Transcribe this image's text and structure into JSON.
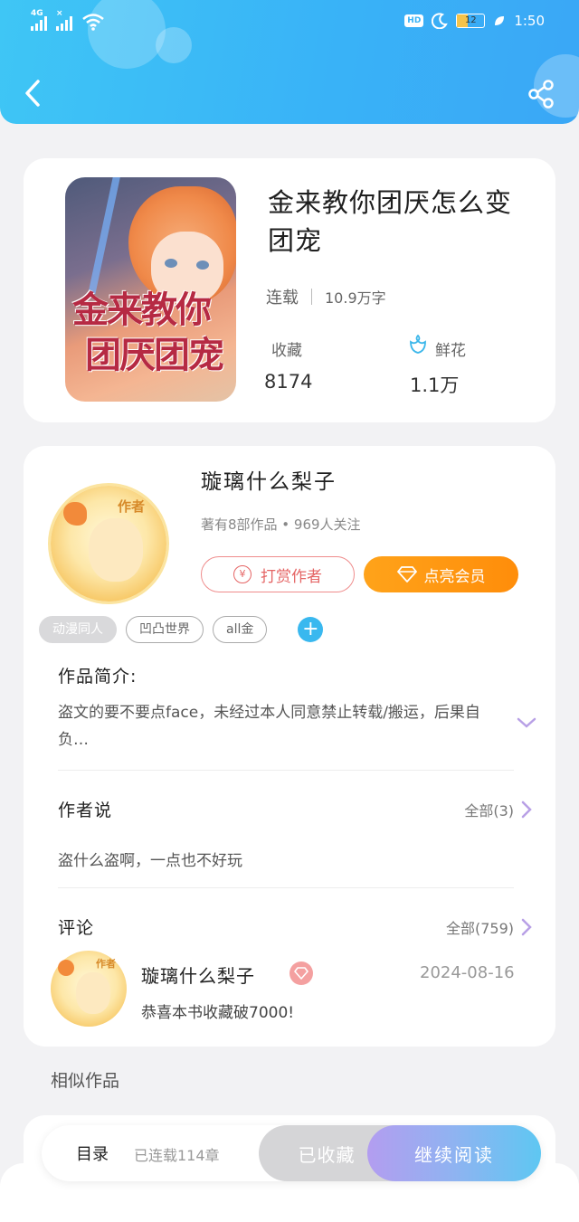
{
  "status_bar": {
    "network": "4G",
    "hd": "HD",
    "battery": "12",
    "time": "1:50"
  },
  "book": {
    "title": "金来教你团厌怎么变团宠",
    "status": "连载",
    "word_count": "10.9万字",
    "favorites_label": "收藏",
    "favorites_value": "8174",
    "flowers_label": "鲜花",
    "flowers_value": "1.1万",
    "cover": {
      "title_line1": "金来教你",
      "title_line2": "团厌团宠"
    }
  },
  "author": {
    "name": "璇璃什么梨子",
    "badge": "作者",
    "meta": "著有8部作品 • 969人关注",
    "tip_button": "打赏作者",
    "vip_button": "点亮会员",
    "yen_symbol": "¥"
  },
  "tags": [
    "动漫同人",
    "凹凸世界",
    "all金"
  ],
  "intro": {
    "label": "作品简介:",
    "text": "盗文的要不要点face，未经过本人同意禁止转载/搬运，后果自负…"
  },
  "author_says": {
    "label": "作者说",
    "more": "全部(3)",
    "text": "盗什么盗啊，一点也不好玩"
  },
  "comments": {
    "label": "评论",
    "more": "全部(759)",
    "item": {
      "name": "璇璃什么梨子",
      "badge": "作者",
      "date": "2024-08-16",
      "text": "恭喜本书收藏破7000!"
    }
  },
  "similar": {
    "label": "相似作品"
  },
  "bottom_bar": {
    "toc": "目录",
    "toc_sub": "已连载114章",
    "favorited": "已收藏",
    "continue": "继续阅读"
  },
  "colors": {
    "header": "#39b3f7",
    "vip": "#ff8d0a",
    "tip": "#e56565",
    "accent": "#39b8ef"
  }
}
